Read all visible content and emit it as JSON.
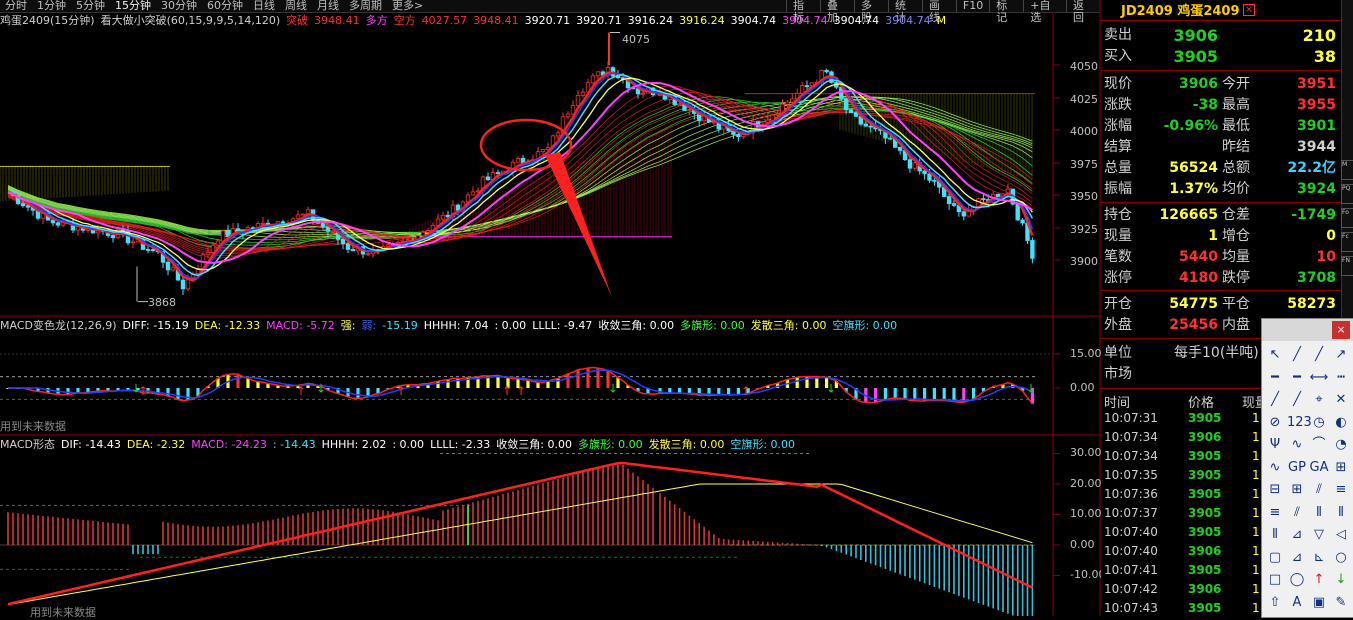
{
  "periods": [
    "分时",
    "1分钟",
    "5分钟",
    "15分钟",
    "30分钟",
    "60分钟",
    "日线",
    "周线",
    "月线",
    "多周期",
    "更多>"
  ],
  "active_period_index": 3,
  "tools": [
    "指标",
    "叠加",
    "多股",
    "统计",
    "画线",
    "F10",
    "标记",
    "+自选",
    "返回"
  ],
  "main_info": {
    "symbol": "鸡蛋2409(15分钟)",
    "indicator": "看大做小突破(60,15,9,9,5,14,120)",
    "tupo_label": "突破",
    "tupo_value": "3948.41",
    "duofang_label": "多方",
    "duofang_value": "4027.57",
    "kongfang_label": "空方",
    "kongfang_value": "4027.57",
    "v1": "3948.41",
    "v2": "3920.71",
    "v3": "3920.71",
    "v4": "3916.24",
    "v5": "3916.24",
    "v6": "3904.74",
    "v7": "3904.74",
    "v8": "3904.74",
    "v9": "3904.74",
    "m": "M"
  },
  "main_axis": [
    "4050",
    "4025",
    "4000",
    "3975",
    "3950",
    "3925",
    "3900"
  ],
  "main_marks": {
    "high": "4075",
    "low": "3868"
  },
  "macd1_info": {
    "name": "MACD变色龙(12,26,9)",
    "diff": "DIFF: -15.19",
    "dea": "DEA: -12.33",
    "macd": "MACD: -5.72",
    "strong": "强:",
    "weak": "弱:",
    "weak_val": "-15.19",
    "hhhh": "HHHH: 7.04",
    "hhhh2": ": 0.00",
    "llll": "LLLL: -9.47",
    "shoulian": "收敛三角: 0.00",
    "duoqi": "多旗形: 0.00",
    "fasan": "发散三角: 0.00",
    "kongqi": "空旗形: 0.00"
  },
  "macd1_axis": [
    "15.00",
    "0.00"
  ],
  "macd1_note": "用到未来数据",
  "macd2_info": {
    "name": "MACD形态",
    "dif": "DIF: -14.43",
    "dea": "DEA: -2.32",
    "macd": "MACD: -24.23",
    "extra": ": -14.43",
    "hhhh": "HHHH: 2.02",
    "hhhh2": ": 0.00",
    "llll": "LLLL: -2.33",
    "shoulian": "收敛三角: 0.00",
    "duoqi": "多旗形: 0.00",
    "fasan": "发散三角: 0.00",
    "kongqi": "空旗形: 0.00"
  },
  "macd2_axis": [
    "30.00",
    "20.00",
    "10.00",
    "0.00",
    "-10.00"
  ],
  "macd2_note": "用到未来数据",
  "quote": {
    "title": "JD2409 鸡蛋2409",
    "sell_label": "卖出",
    "sell_price": "3906",
    "sell_vol": "210",
    "buy_label": "买入",
    "buy_price": "3905",
    "buy_vol": "38",
    "rows": [
      {
        "l": "现价",
        "v": "3906",
        "vc": "#20d020",
        "l2": "今开",
        "v2": "3951",
        "v2c": "#ff3030"
      },
      {
        "l": "涨跌",
        "v": "-38",
        "vc": "#20d020",
        "l2": "最高",
        "v2": "3955",
        "v2c": "#ff3030"
      },
      {
        "l": "涨幅",
        "v": "-0.96%",
        "vc": "#20d020",
        "l2": "最低",
        "v2": "3901",
        "v2c": "#20d020"
      },
      {
        "l": "结算",
        "v": "",
        "vc": "#d0d0d0",
        "l2": "昨结",
        "v2": "3944",
        "v2c": "#d0d0d0"
      },
      {
        "l": "总量",
        "v": "56524",
        "vc": "#ffff40",
        "l2": "总额",
        "v2": "22.2亿",
        "v2c": "#40d0ff"
      },
      {
        "l": "振幅",
        "v": "1.37%",
        "vc": "#ffff40",
        "l2": "均价",
        "v2": "3924",
        "v2c": "#20d020"
      }
    ],
    "rows2": [
      {
        "l": "持仓",
        "v": "126665",
        "vc": "#ffff40",
        "l2": "仓差",
        "v2": "-1749",
        "v2c": "#20d020"
      },
      {
        "l": "现量",
        "v": "1",
        "vc": "#ffff40",
        "l2": "增仓",
        "v2": "0",
        "v2c": "#ffff40"
      },
      {
        "l": "笔数",
        "v": "5440",
        "vc": "#ff3030",
        "l2": "均量",
        "v2": "10",
        "v2c": "#ff3030"
      },
      {
        "l": "涨停",
        "v": "4180",
        "vc": "#ff3030",
        "l2": "跌停",
        "v2": "3708",
        "v2c": "#20d020"
      }
    ],
    "rows3": [
      {
        "l": "开仓",
        "v": "54775",
        "vc": "#ffff40",
        "l2": "平仓",
        "v2": "58273",
        "v2c": "#ffff40"
      },
      {
        "l": "外盘",
        "v": "25456",
        "vc": "#ff3030",
        "l2": "内盘",
        "v2": "",
        "v2c": "#20d020"
      }
    ],
    "unit_label": "单位",
    "unit_value": "每手10(半吨)",
    "market_label": "市场",
    "tick_head": {
      "time": "时间",
      "price": "价格",
      "vol": "现量"
    },
    "ticks": [
      {
        "t": "10:07:31",
        "p": "3905",
        "q": "1"
      },
      {
        "t": "10:07:34",
        "p": "3906",
        "q": "1"
      },
      {
        "t": "10:07:34",
        "p": "3905",
        "q": "1"
      },
      {
        "t": "10:07:35",
        "p": "3905",
        "q": "1"
      },
      {
        "t": "10:07:36",
        "p": "3905",
        "q": "1"
      },
      {
        "t": "10:07:37",
        "p": "3905",
        "q": "1"
      },
      {
        "t": "10:07:40",
        "p": "3905",
        "q": "1"
      },
      {
        "t": "10:07:40",
        "p": "3906",
        "q": "1"
      },
      {
        "t": "10:07:41",
        "p": "3905",
        "q": "1"
      },
      {
        "t": "10:07:42",
        "p": "3906",
        "q": "1"
      },
      {
        "t": "10:07:43",
        "p": "3905",
        "q": "1"
      }
    ]
  },
  "toolbox": {
    "close": "×",
    "tools": [
      "↖",
      "╱",
      "╱",
      "↗",
      "━",
      "━",
      "⟷",
      "┅",
      "╱",
      "╱",
      "⌖",
      "✕",
      "⊘",
      "123",
      "◷",
      "◐",
      "Ψ",
      "∿",
      "⌒",
      "◔",
      "∿",
      "GP",
      "GA",
      "⊞",
      "⊟",
      "⊞",
      "⫽",
      "≡",
      "≡",
      "⫽",
      "⦀",
      "⦀",
      "⦀",
      "⊿",
      "▽",
      "◁",
      "▢",
      "⊿",
      "⊾",
      "○",
      "□",
      "◯",
      "↑",
      "↓",
      "⇧",
      "A",
      "▣",
      "✎"
    ]
  },
  "side_buttons": [
    "M",
    "PQ",
    "Fo",
    "Fc",
    "FN"
  ],
  "colors": {
    "up": "#ff3030",
    "down": "#20d020",
    "accent": "#ffff40",
    "cyan": "#40e0ff",
    "magenta": "#ff40ff"
  }
}
